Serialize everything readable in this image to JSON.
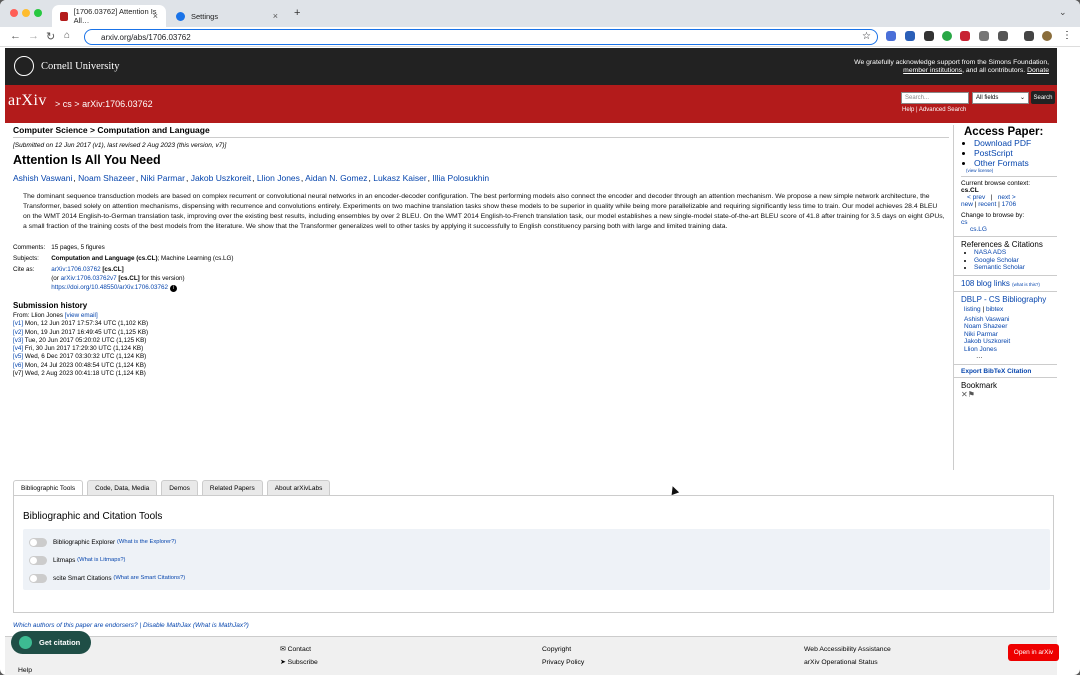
{
  "browser": {
    "tabs": [
      {
        "label": "[1706.03762] Attention Is All…",
        "active": true
      },
      {
        "label": "Settings",
        "active": false
      }
    ],
    "new_tab": "+",
    "url": "arxiv.org/abs/1706.03762"
  },
  "cornell": {
    "name": "Cornell University",
    "ack_line1": "We gratefully acknowledge support from the Simons Foundation,",
    "ack_link": "member institutions",
    "ack_line2": ", and all contributors.",
    "donate": "Donate"
  },
  "header": {
    "logo": "arXiv",
    "breadcrumb_sep": ">",
    "breadcrumb_cs": "cs",
    "breadcrumb_id": "arXiv:1706.03762",
    "search_placeholder": "Search...",
    "search_field": "All fields",
    "search_button": "Search",
    "help": "Help",
    "sep": "|",
    "advanced": "Advanced Search"
  },
  "main": {
    "subheader": "Computer Science > Computation and Language",
    "dateline": "[Submitted on 12 Jun 2017 (v1), last revised 2 Aug 2023 (this version, v7)]",
    "title": "Attention Is All You Need",
    "authors": [
      "Ashish Vaswani",
      "Noam Shazeer",
      "Niki Parmar",
      "Jakob Uszkoreit",
      "Llion Jones",
      "Aidan N. Gomez",
      "Lukasz Kaiser",
      "Illia Polosukhin"
    ],
    "abstract": "The dominant sequence transduction models are based on complex recurrent or convolutional neural networks in an encoder-decoder configuration. The best performing models also connect the encoder and decoder through an attention mechanism. We propose a new simple network architecture, the Transformer, based solely on attention mechanisms, dispensing with recurrence and convolutions entirely. Experiments on two machine translation tasks show these models to be superior in quality while being more parallelizable and requiring significantly less time to train. Our model achieves 28.4 BLEU on the WMT 2014 English-to-German translation task, improving over the existing best results, including ensembles by over 2 BLEU. On the WMT 2014 English-to-French translation task, our model establishes a new single-model state-of-the-art BLEU score of 41.8 after training for 3.5 days on eight GPUs, a small fraction of the training costs of the best models from the literature. We show that the Transformer generalizes well to other tasks by applying it successfully to English constituency parsing both with large and limited training data.",
    "comments_label": "Comments:",
    "comments": "15 pages, 5 figures",
    "subjects_label": "Subjects:",
    "subjects_bold": "Computation and Language (cs.CL)",
    "subjects_rest": "; Machine Learning (cs.LG)",
    "cite_label": "Cite as:",
    "cite_id": "arXiv:1706.03762",
    "cite_cat": "[cs.CL]",
    "cite_or": "(or",
    "cite_v7": "arXiv:1706.03762v7",
    "cite_tail": "for this version)",
    "doi": "https://doi.org/10.48550/arXiv.1706.03762",
    "history_title": "Submission history",
    "history_from": "From: Llion Jones",
    "view_email": "[view email]",
    "versions": [
      {
        "v": "[v1]",
        "date": "Mon, 12 Jun 2017 17:57:34 UTC (1,102 KB)"
      },
      {
        "v": "[v2]",
        "date": "Mon, 19 Jun 2017 16:49:45 UTC (1,125 KB)"
      },
      {
        "v": "[v3]",
        "date": "Tue, 20 Jun 2017 05:20:02 UTC (1,125 KB)"
      },
      {
        "v": "[v4]",
        "date": "Fri, 30 Jun 2017 17:29:30 UTC (1,124 KB)"
      },
      {
        "v": "[v5]",
        "date": "Wed, 6 Dec 2017 03:30:32 UTC (1,124 KB)"
      },
      {
        "v": "[v6]",
        "date": "Mon, 24 Jul 2023 00:48:54 UTC (1,124 KB)"
      },
      {
        "v": "[v7]",
        "date": "Wed, 2 Aug 2023 00:41:18 UTC (1,124 KB)"
      }
    ]
  },
  "labs": {
    "tabs": [
      "Bibliographic Tools",
      "Code, Data, Media",
      "Demos",
      "Related Papers",
      "About arXivLabs"
    ],
    "panel_title": "Bibliographic and Citation Tools",
    "tools": [
      {
        "label": "Bibliographic Explorer",
        "help": "(What is the Explorer?)"
      },
      {
        "label": "Litmaps",
        "help": "(What is Litmaps?)"
      },
      {
        "label": "scite Smart Citations",
        "help": "(What are Smart Citations?)"
      }
    ],
    "endorsers": "Which authors of this paper are endorsers?",
    "sep": "|",
    "mathjax": "Disable MathJax",
    "what_mathjax": "(What is MathJax?)"
  },
  "sidebar": {
    "access_title": "Access Paper:",
    "downloads": [
      "Download PDF",
      "PostScript",
      "Other Formats"
    ],
    "view_license": "(view license)",
    "context_label": "Current browse context:",
    "context": "cs.CL",
    "prev": "< prev",
    "next": "next >",
    "pipe": "|",
    "new": "new",
    "recent": "recent",
    "month": "1706",
    "change_label": "Change to browse by:",
    "browse_cs": "cs",
    "browse_lg": "cs.LG",
    "refs_title": "References & Citations",
    "refs": [
      "NASA ADS",
      "Google Scholar",
      "Semantic Scholar"
    ],
    "blog": "108 blog links",
    "blog_help": "(what is this?)",
    "dblp_title": "DBLP - CS Bibliography",
    "listing": "listing",
    "bibtex": "bibtex",
    "dblp_authors": [
      "Ashish Vaswani",
      "Noam Shazeer",
      "Niki Parmar",
      "Jakob Uszkoreit",
      "Llion Jones"
    ],
    "ellipsis": "…",
    "export": "Export BibTeX Citation",
    "bookmark": "Bookmark"
  },
  "footer": {
    "contact": "Contact",
    "subscribe": "Subscribe",
    "copyright": "Copyright",
    "privacy": "Privacy Policy",
    "accessibility": "Web Accessibility Assistance",
    "status": "arXiv Operational Status",
    "help": "Help"
  },
  "widgets": {
    "get_citation": "Get citation",
    "open_in_arxiv": "Open in arXiv"
  },
  "colors": {
    "arxiv_red": "#b31b1b",
    "cornell_black": "#222222",
    "link": "#0645ad"
  }
}
